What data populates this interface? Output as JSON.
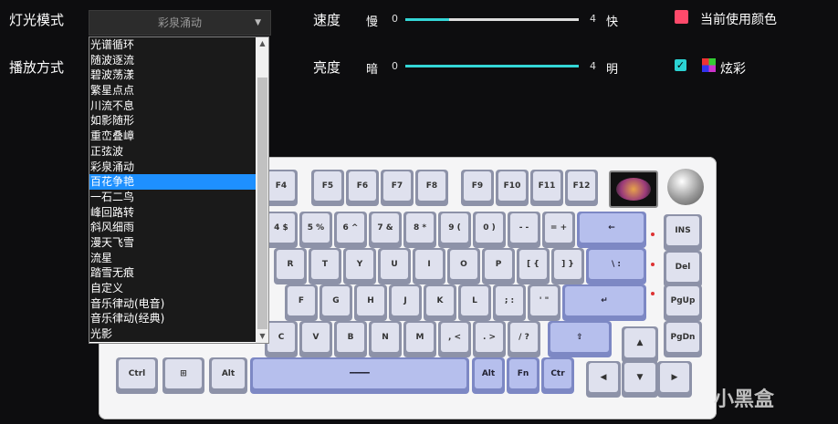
{
  "labels": {
    "mode": "灯光模式",
    "play": "播放方式",
    "speed": "速度",
    "bright": "亮度",
    "current_color": "当前使用颜色",
    "colorful": "炫彩"
  },
  "dropdown": {
    "value": "彩泉涌动"
  },
  "list": [
    "光谱循环",
    "随波逐流",
    "碧波荡漾",
    "繁星点点",
    "川流不息",
    "如影随形",
    "重峦叠嶂",
    "正弦波",
    "彩泉涌动",
    "百花争艳",
    "一石二鸟",
    "峰回路转",
    "斜风细雨",
    "漫天飞雪",
    "流星",
    "踏雪无痕",
    "自定义",
    "音乐律动(电音)",
    "音乐律动(经典)",
    "光影"
  ],
  "selected_index": 9,
  "speed": {
    "min": "0",
    "max": "4",
    "slow": "慢",
    "fast": "快",
    "value": 1
  },
  "brightness": {
    "min": "0",
    "max": "4",
    "dark": "暗",
    "light": "明",
    "value": 4
  },
  "colors": {
    "swatch": "#ff4a6b",
    "accent": "#34d6d6"
  },
  "keys": {
    "f4": "F4",
    "f5": "F5",
    "f6": "F6",
    "f7": "F7",
    "f8": "F8",
    "f9": "F9",
    "f10": "F10",
    "f11": "F11",
    "f12": "F12",
    "n4": "4 $",
    "n5": "5 %",
    "n6": "6 ^",
    "n7": "7 &",
    "n8": "8 *",
    "n9": "9 (",
    "n0": "0 )",
    "minus": "- -",
    "eq": "= +",
    "bksp": "←",
    "r": "R",
    "t": "T",
    "y": "Y",
    "u": "U",
    "i": "I",
    "o": "O",
    "p": "P",
    "lb": "[ {",
    "rb": "] }",
    "bs": "\\ :",
    "f": "F",
    "g": "G",
    "h": "H",
    "j": "J",
    "k": "K",
    "l": "L",
    "semi": "; :",
    "quote": "' \"",
    "enter": "↵",
    "c": "C",
    "v": "V",
    "b": "B",
    "n": "N",
    "m": "M",
    "comma": ", <",
    "dot": ". >",
    "slash": "/ ?",
    "shift": "⇧",
    "ctrl": "Ctrl",
    "alt": "Alt",
    "ralt": "Alt",
    "fn": "Fn",
    "rctrl": "Ctr",
    "ins": "INS",
    "del": "Del",
    "pgup": "PgUp",
    "pgdn": "PgDn",
    "up": "▲",
    "left": "◀",
    "down": "▼",
    "right": "▶",
    "space": "━━━━"
  },
  "watermark": "小黑盒"
}
